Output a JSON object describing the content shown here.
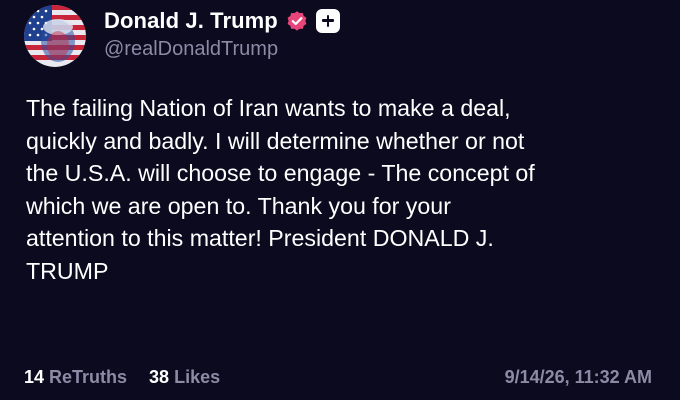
{
  "post": {
    "author": {
      "display_name": "Donald J. Trump",
      "handle": "@realDonaldTrump",
      "verified_icon": "verified-badge-icon",
      "follow_icon": "plus-icon"
    },
    "text": "The failing Nation of Iran wants to make a deal,\nquickly and badly. I will determine whether or not\nthe U.S.A. will choose to engage - The concept of\nwhich we are open to. Thank you for your\nattention to this matter! President DONALD J.\nTRUMP",
    "stats": {
      "retruths_count": "14",
      "retruths_label": "ReTruths",
      "likes_count": "38",
      "likes_label": "Likes"
    },
    "timestamp": "9/14/26, 11:32 AM"
  },
  "colors": {
    "background": "#0b0a1f",
    "text": "#ffffff",
    "muted": "#8e8aa6",
    "verified": "#e8457a"
  }
}
